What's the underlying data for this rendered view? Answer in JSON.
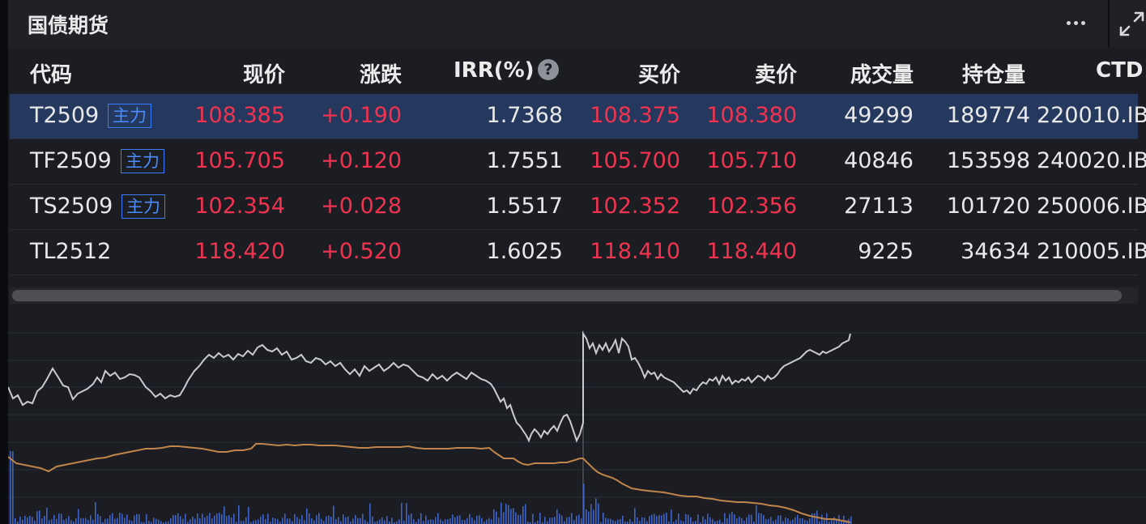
{
  "header": {
    "title": "国债期货"
  },
  "columns": {
    "code": "代码",
    "price": "现价",
    "change": "涨跌",
    "irr": "IRR(%)",
    "help": "?",
    "bid": "买价",
    "ask": "卖价",
    "volume": "成交量",
    "oi": "持仓量",
    "ctd": "CTD"
  },
  "rows": [
    {
      "code": "T2509",
      "tag": "主力",
      "price": "108.385",
      "change": "+0.190",
      "irr": "1.7368",
      "bid": "108.375",
      "ask": "108.380",
      "volume": "49299",
      "oi": "189774",
      "ctd": "220010.IB"
    },
    {
      "code": "TF2509",
      "tag": "主力",
      "price": "105.705",
      "change": "+0.120",
      "irr": "1.7551",
      "bid": "105.700",
      "ask": "105.710",
      "volume": "40846",
      "oi": "153598",
      "ctd": "240020.IB"
    },
    {
      "code": "TS2509",
      "tag": "主力",
      "price": "102.354",
      "change": "+0.028",
      "irr": "1.5517",
      "bid": "102.352",
      "ask": "102.356",
      "volume": "27113",
      "oi": "101720",
      "ctd": "250006.IB"
    },
    {
      "code": "TL2512",
      "tag": "",
      "price": "118.420",
      "change": "+0.520",
      "irr": "1.6025",
      "bid": "118.410",
      "ask": "118.440",
      "volume": "9225",
      "oi": "34634",
      "ctd": "210005.IB"
    }
  ],
  "colors": {
    "up": "#f2334f",
    "selected_row": "#25395f",
    "tag": "#3a7cff",
    "price_line": "#c9cbd1",
    "avg_line": "#c0854a",
    "volume_bar": "#3f63c6"
  },
  "icons": {
    "more": "more-horizontal-icon",
    "expand": "expand-icon",
    "help": "help-circle-icon"
  }
}
